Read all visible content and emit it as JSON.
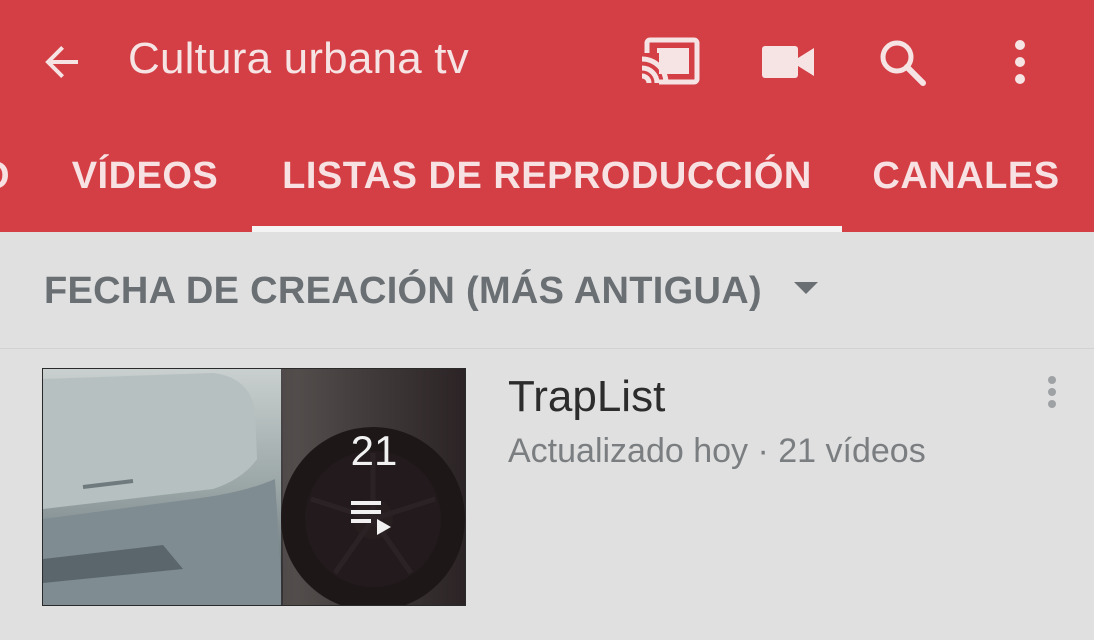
{
  "header": {
    "title": "Cultura urbana tv",
    "icons": [
      "back-arrow-icon",
      "cast-icon",
      "video-camera-icon",
      "search-icon",
      "more-vert-icon"
    ],
    "accent_color": "#d33f45"
  },
  "tabs": [
    {
      "label": "O",
      "active": false
    },
    {
      "label": "VÍDEOS",
      "active": false
    },
    {
      "label": "LISTAS DE REPRODUCCIÓN",
      "active": true
    },
    {
      "label": "CANALES",
      "active": false
    }
  ],
  "sort": {
    "label": "FECHA DE CREACIÓN (MÁS ANTIGUA)"
  },
  "playlists": [
    {
      "title": "TrapList",
      "meta": "Actualizado hoy · 21 vídeos",
      "count": "21",
      "icon": "playlist-play-icon"
    }
  ]
}
